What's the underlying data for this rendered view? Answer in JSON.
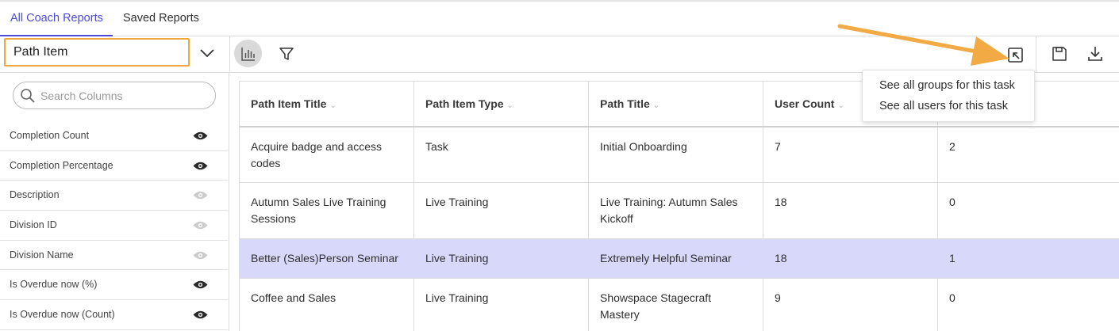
{
  "tabs": [
    {
      "label": "All Coach Reports",
      "active": true
    },
    {
      "label": "Saved Reports",
      "active": false
    }
  ],
  "toolbar": {
    "group_by_value": "Path Item",
    "icons": [
      "chevron-down-icon",
      "bar-chart-icon",
      "filter-icon",
      "export-icon",
      "save-icon",
      "download-icon"
    ]
  },
  "sidebar": {
    "search_placeholder": "Search Columns",
    "columns": [
      {
        "label": "Completion Count",
        "visible": true
      },
      {
        "label": "Completion Percentage",
        "visible": true
      },
      {
        "label": "Description",
        "visible": false
      },
      {
        "label": "Division ID",
        "visible": false
      },
      {
        "label": "Division Name",
        "visible": false
      },
      {
        "label": "Is Overdue now (%)",
        "visible": true
      },
      {
        "label": "Is Overdue now (Count)",
        "visible": true
      }
    ]
  },
  "table": {
    "headers": [
      "Path Item Title",
      "Path Item Type",
      "Path Title",
      "User Count",
      ""
    ],
    "rows": [
      [
        "Acquire badge and access codes",
        "Task",
        "Initial Onboarding",
        "7",
        "2"
      ],
      [
        "Autumn Sales Live Training Sessions",
        "Live Training",
        "Live Training: Autumn Sales Kickoff",
        "18",
        "0"
      ],
      [
        "Better (Sales)Person Seminar",
        "Live Training",
        "Extremely Helpful Seminar",
        "18",
        "1"
      ],
      [
        "Coffee and Sales",
        "Live Training",
        "Showspace Stagecraft Mastery",
        "9",
        "0"
      ]
    ],
    "highlighted_row": 2
  },
  "menu": {
    "items": [
      "See all groups for this task",
      "See all users for this task"
    ]
  },
  "colors": {
    "accent": "#4b4bd6",
    "highlight_box": "#f0a63a",
    "row_highlight": "#d8d8fb",
    "arrow": "#f2aa45"
  }
}
